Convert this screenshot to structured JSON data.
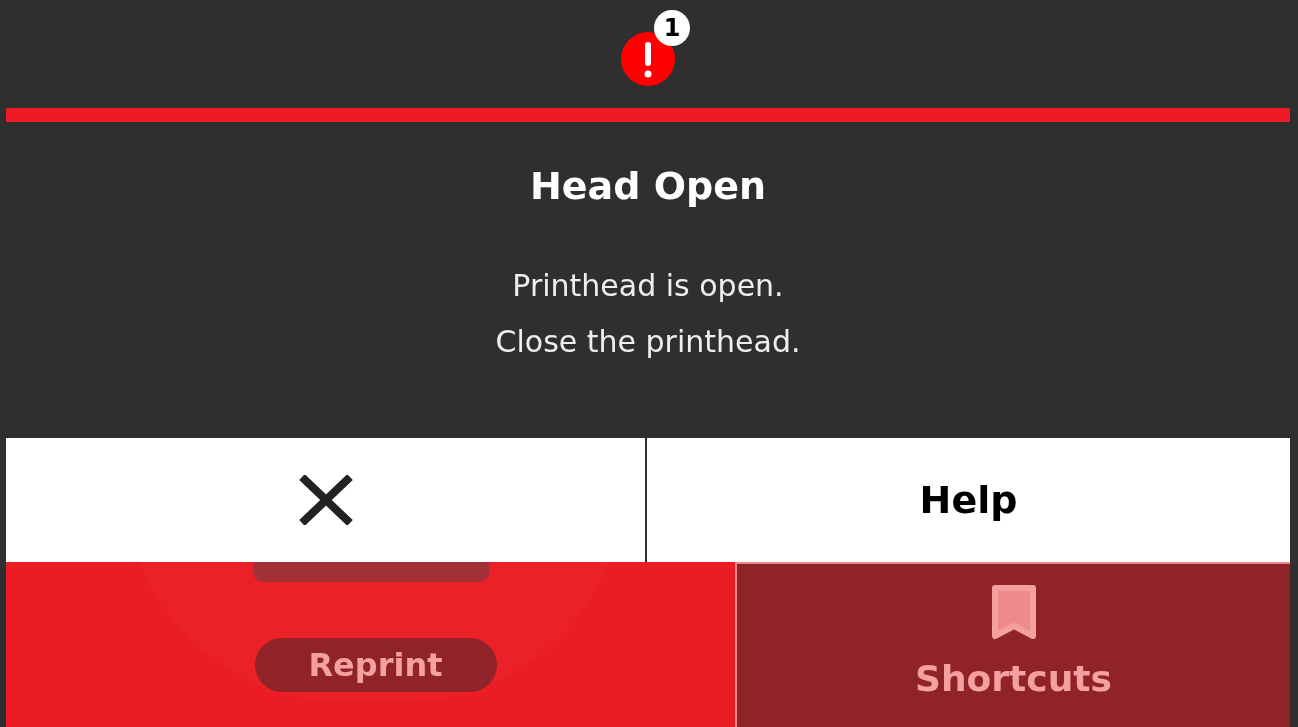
{
  "status_bar": {
    "alert_count": "1"
  },
  "alert": {
    "title": "Head Open",
    "message": [
      "Printhead is open.",
      "Close the printhead."
    ]
  },
  "actions": [
    {
      "kind": "close"
    },
    {
      "kind": "text",
      "label": "Help"
    }
  ],
  "bottom": {
    "reprint": {
      "label": "Reprint"
    },
    "shortcuts": {
      "label": "Shortcuts"
    }
  }
}
